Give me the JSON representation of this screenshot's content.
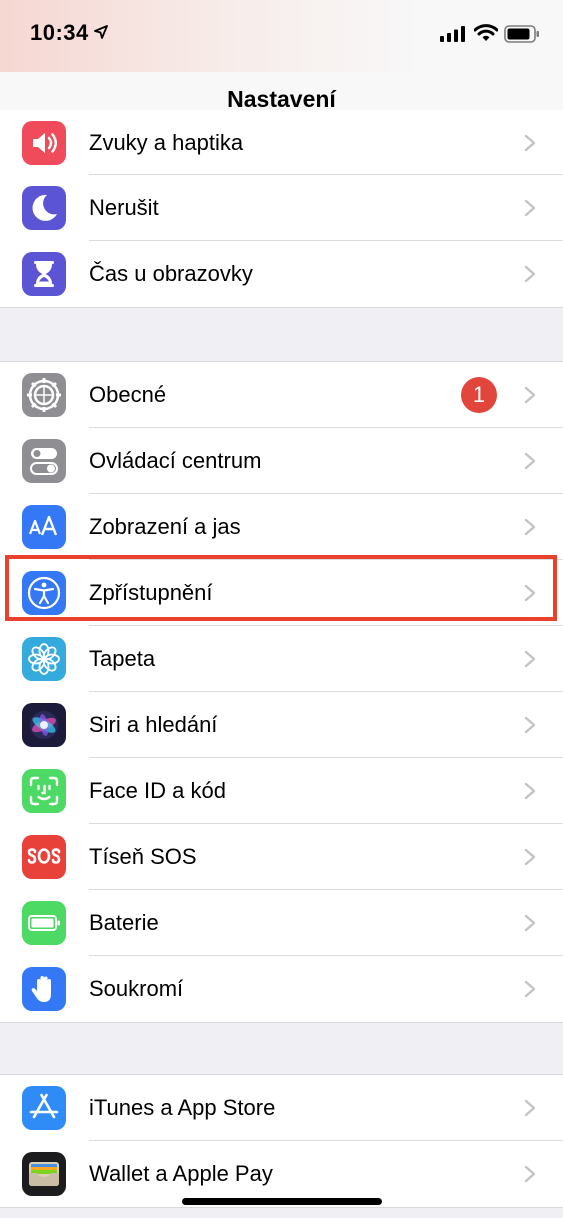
{
  "status_bar": {
    "time": "10:34"
  },
  "nav": {
    "title": "Nastavení"
  },
  "groups": [
    {
      "items": [
        {
          "label": "Zvuky a haptika",
          "icon": "speaker-icon",
          "color": "#f04b5a"
        },
        {
          "label": "Nerušit",
          "icon": "moon-icon",
          "color": "#5b55d6"
        },
        {
          "label": "Čas u obrazovky",
          "icon": "hourglass-icon",
          "color": "#5b55d6"
        }
      ]
    },
    {
      "items": [
        {
          "label": "Obecné",
          "icon": "gear-icon",
          "color": "#8e8e93",
          "badge": "1"
        },
        {
          "label": "Ovládací centrum",
          "icon": "toggles-icon",
          "color": "#8e8e93"
        },
        {
          "label": "Zobrazení a jas",
          "icon": "text-size-icon",
          "color": "#3478f6"
        },
        {
          "label": "Zpřístupnění",
          "icon": "accessibility-icon",
          "color": "#3478f6",
          "highlighted": true
        },
        {
          "label": "Tapeta",
          "icon": "flower-icon",
          "color": "#35aadc"
        },
        {
          "label": "Siri a hledání",
          "icon": "siri-icon",
          "color": "#1c1c3a"
        },
        {
          "label": "Face ID a kód",
          "icon": "face-id-icon",
          "color": "#4cd964"
        },
        {
          "label": "Tíseň SOS",
          "icon": "sos-icon",
          "color": "#e8413a"
        },
        {
          "label": "Baterie",
          "icon": "battery-icon",
          "color": "#4cd964"
        },
        {
          "label": "Soukromí",
          "icon": "hand-icon",
          "color": "#3478f6"
        }
      ]
    },
    {
      "items": [
        {
          "label": "iTunes a App Store",
          "icon": "app-store-icon",
          "color": "#2f8cf6"
        },
        {
          "label": "Wallet a Apple Pay",
          "icon": "wallet-icon",
          "color": "#1c1c1e"
        }
      ]
    }
  ]
}
